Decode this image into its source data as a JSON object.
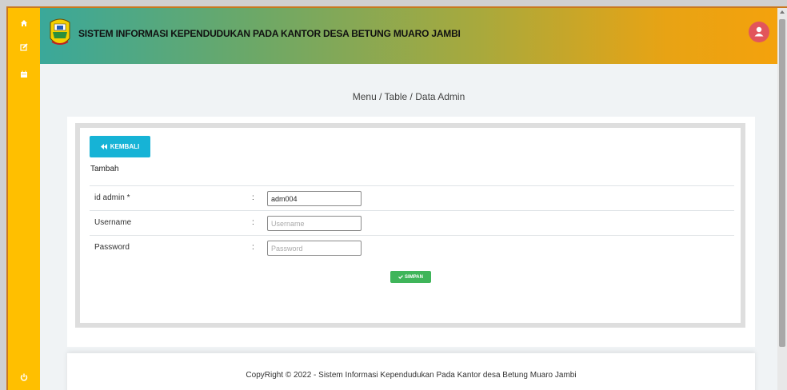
{
  "header": {
    "title": "SISTEM INFORMASI KEPENDUDUKAN PADA KANTOR DESA BETUNG MUARO JAMBI"
  },
  "sidebar": {
    "icons": [
      "home-icon",
      "edit-icon",
      "calendar-icon",
      "power-icon"
    ]
  },
  "breadcrumb": "Menu / Table / Data Admin",
  "form": {
    "back_label": "KEMBALI",
    "heading": "Tambah",
    "fields": [
      {
        "label": "id admin  *",
        "colon": ":",
        "value": "adm004",
        "placeholder": ""
      },
      {
        "label": "Username",
        "colon": ":",
        "value": "",
        "placeholder": "Username"
      },
      {
        "label": "Password",
        "colon": ":",
        "value": "",
        "placeholder": "Password"
      }
    ],
    "save_label": "SIMPAN"
  },
  "footer": {
    "text": "CopyRight © 2022 - Sistem Informasi Kependudukan Pada Kantor desa Betung Muaro Jambi"
  },
  "colors": {
    "sidebar": "#ffbf00",
    "back_button": "#16b3d6",
    "save_button": "#3fb55a",
    "avatar": "#e2555b"
  }
}
